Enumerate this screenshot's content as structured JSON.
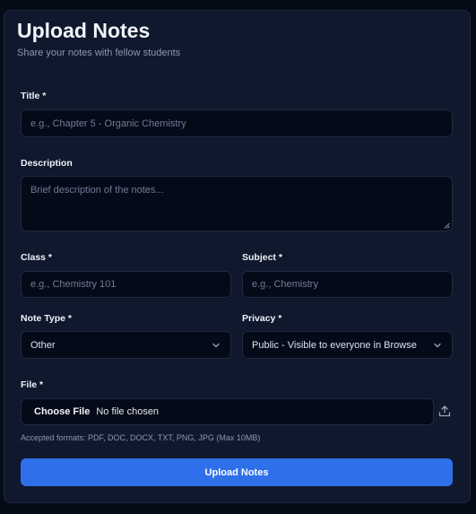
{
  "header": {
    "title": "Upload Notes",
    "subtitle": "Share your notes with fellow students"
  },
  "form": {
    "title": {
      "label": "Title *",
      "placeholder": "e.g., Chapter 5 - Organic Chemistry"
    },
    "description": {
      "label": "Description",
      "placeholder": "Brief description of the notes..."
    },
    "class": {
      "label": "Class *",
      "placeholder": "e.g., Chemistry 101"
    },
    "subject": {
      "label": "Subject *",
      "placeholder": "e.g., Chemistry"
    },
    "note_type": {
      "label": "Note Type *",
      "value": "Other"
    },
    "privacy": {
      "label": "Privacy *",
      "value": "Public - Visible to everyone in Browse"
    },
    "file": {
      "label": "File *",
      "button": "Choose File",
      "status": "No file chosen",
      "hint": "Accepted formats: PDF, DOC, DOCX, TXT, PNG, JPG (Max 10MB)"
    },
    "submit_label": "Upload Notes"
  },
  "colors": {
    "background": "#060b18",
    "card": "#0f182c",
    "input": "#050a18",
    "accent": "#2f6fe9"
  },
  "icons": {
    "select_chevron": "chevron-down-icon",
    "file_action": "upload-icon"
  }
}
